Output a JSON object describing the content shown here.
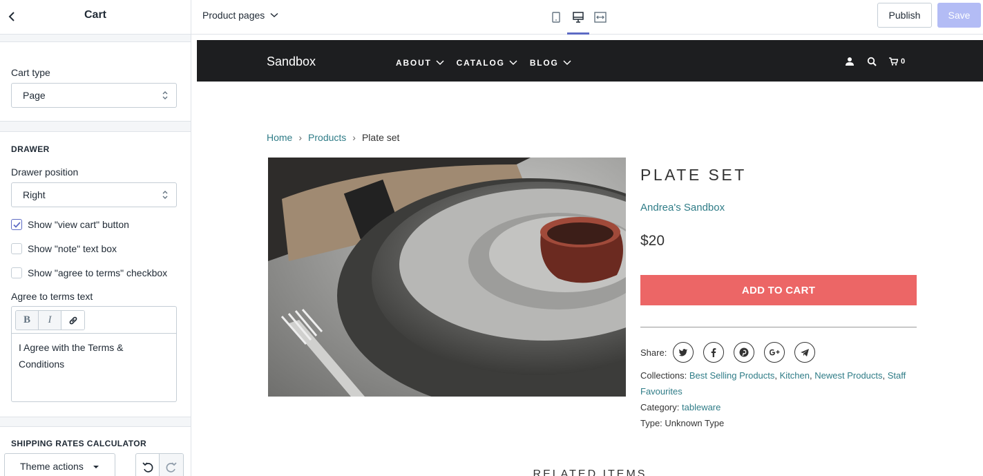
{
  "sidebar": {
    "title": "Cart",
    "cart_type_label": "Cart type",
    "cart_type_value": "Page",
    "drawer_heading": "DRAWER",
    "drawer_position_label": "Drawer position",
    "drawer_position_value": "Right",
    "checkboxes": [
      {
        "label": "Show \"view cart\" button",
        "checked": true
      },
      {
        "label": "Show \"note\" text box",
        "checked": false
      },
      {
        "label": "Show \"agree to terms\" checkbox",
        "checked": false
      }
    ],
    "agree_label": "Agree to terms text",
    "rte_bold": "B",
    "rte_italic": "I",
    "agree_text": "I Agree with the Terms & Conditions",
    "shipping_heading": "SHIPPING RATES CALCULATOR",
    "theme_actions": "Theme actions"
  },
  "topbar": {
    "page_selector": "Product pages",
    "publish": "Publish",
    "save": "Save",
    "accent": "#5c6ac4"
  },
  "store": {
    "logo": "Sandbox",
    "menu": [
      "ABOUT",
      "CATALOG",
      "BLOG"
    ],
    "cart_count": "0",
    "breadcrumb": {
      "home": "Home",
      "products": "Products",
      "current": "Plate set"
    },
    "product_title": "PLATE SET",
    "vendor": "Andrea's Sandbox",
    "price": "$20",
    "add_to_cart": "ADD TO CART",
    "share_label": "Share:",
    "collections_label": "Collections:",
    "collections": [
      "Best Selling Products",
      "Kitchen",
      "Newest Products",
      "Staff Favourites"
    ],
    "category_label": "Category:",
    "category": "tableware",
    "type_label": "Type:",
    "type": "Unknown Type",
    "related": "RELATED ITEMS",
    "button_color": "#ec6666",
    "link_color": "#2f7c87"
  }
}
